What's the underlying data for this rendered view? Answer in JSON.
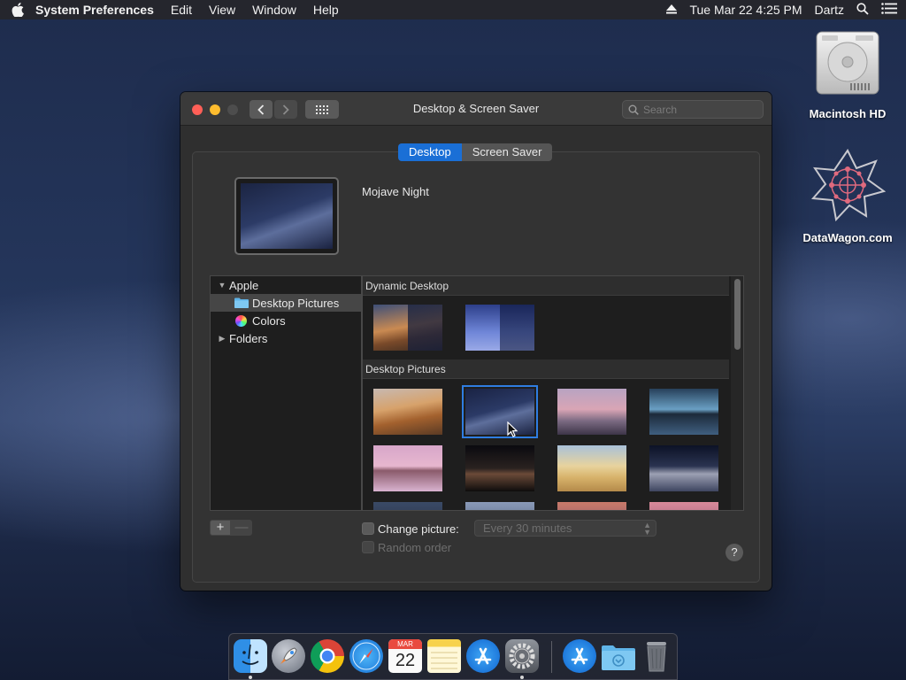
{
  "menubar": {
    "app_name": "System Preferences",
    "menus": [
      "Edit",
      "View",
      "Window",
      "Help"
    ],
    "datetime": "Tue Mar 22  4:25 PM",
    "user": "Dartz"
  },
  "desktop_icons": [
    {
      "label": "Macintosh HD",
      "icon": "hard-drive-icon"
    },
    {
      "label": "DataWagon.com",
      "icon": "datawagon-logo-icon"
    }
  ],
  "window": {
    "title": "Desktop & Screen Saver",
    "search_placeholder": "Search",
    "tabs": [
      {
        "label": "Desktop",
        "active": true
      },
      {
        "label": "Screen Saver",
        "active": false
      }
    ],
    "current_wallpaper": "Mojave Night",
    "sidebar": {
      "apple": "Apple",
      "desktop_pictures": "Desktop Pictures",
      "colors": "Colors",
      "folders": "Folders"
    },
    "sections": {
      "dynamic": "Dynamic Desktop",
      "pictures": "Desktop Pictures"
    },
    "change_picture_label": "Change picture:",
    "interval_value": "Every 30 minutes",
    "random_order_label": "Random order",
    "plus": "+",
    "minus": "—",
    "help": "?"
  },
  "dock": [
    {
      "name": "Finder",
      "icon": "finder-icon"
    },
    {
      "name": "Launchpad",
      "icon": "launchpad-icon"
    },
    {
      "name": "Chrome",
      "icon": "chrome-icon"
    },
    {
      "name": "Safari",
      "icon": "safari-icon"
    },
    {
      "name": "Calendar",
      "icon": "calendar-icon",
      "month": "MAR",
      "day": "22"
    },
    {
      "name": "Notes",
      "icon": "notes-icon"
    },
    {
      "name": "App Store",
      "icon": "app-store-icon"
    },
    {
      "name": "System Preferences",
      "icon": "system-preferences-icon"
    },
    {
      "name": "App Store Downloads",
      "icon": "app-store-icon"
    },
    {
      "name": "Downloads",
      "icon": "downloads-folder-icon"
    },
    {
      "name": "Trash",
      "icon": "trash-icon"
    }
  ],
  "colors": {
    "accent": "#1a6fd6",
    "close": "#ff5f57",
    "minimize": "#febc2e"
  }
}
